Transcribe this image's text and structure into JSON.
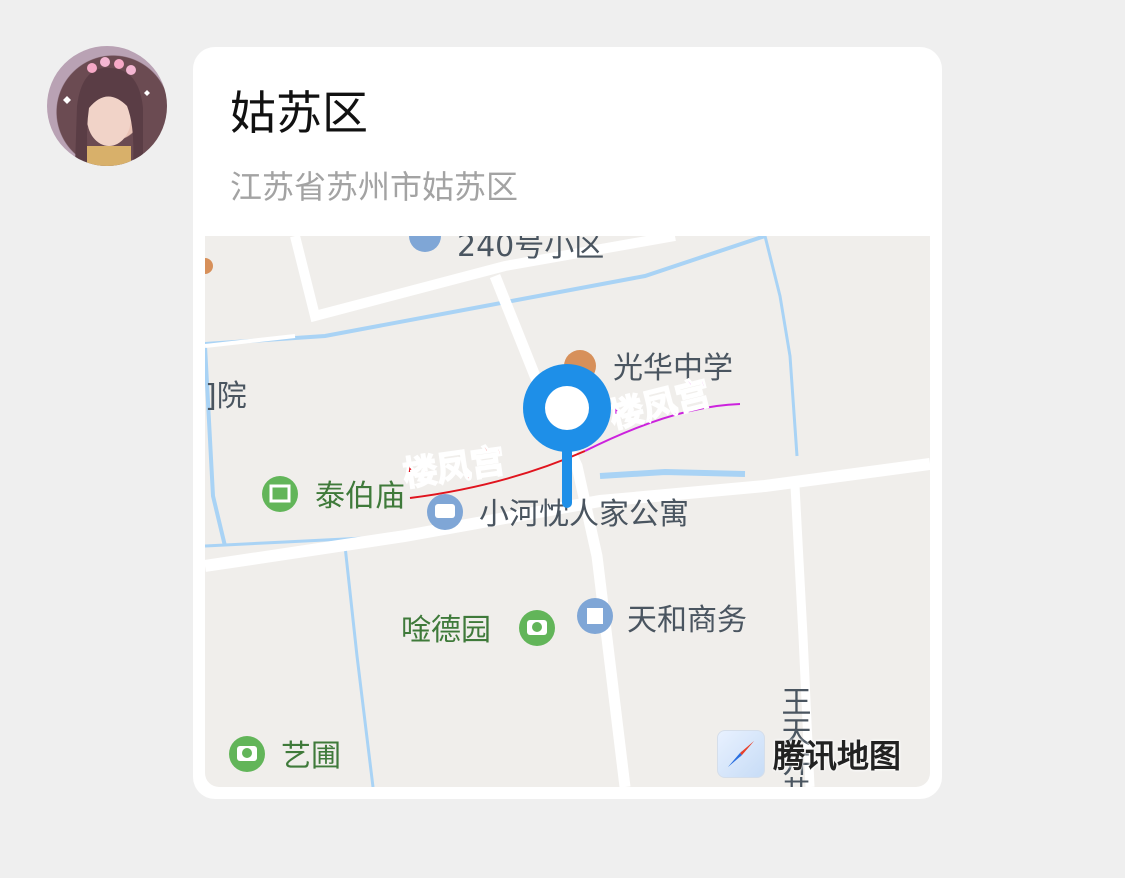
{
  "location": {
    "title": "姑苏区",
    "address": "江苏省苏州市姑苏区"
  },
  "map": {
    "labels": {
      "top_community": "240号小区",
      "school": "光华中学",
      "hospital_partial": "]院",
      "temple": "泰伯庙",
      "apartment": "小河忱人家公寓",
      "garden": "唫德园",
      "business": "天和商务",
      "art_garden": "艺圃",
      "street_vertical": "王天井巷"
    },
    "sticker_text_left": "楼凤宫",
    "sticker_text_right": "楼凤宫",
    "provider": "腾讯地图",
    "colors": {
      "pin": "#1e8fe8",
      "water": "#a9d3f5",
      "sticker_left": "#e0141e",
      "sticker_right": "#cc22dd"
    }
  }
}
